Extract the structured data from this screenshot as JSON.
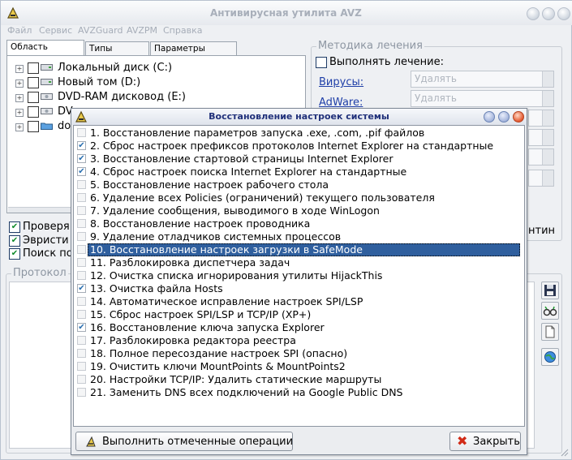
{
  "app": {
    "title": "Антивирусная утилита AVZ"
  },
  "menu": [
    "Файл",
    "Сервис",
    "AVZGuard",
    "AVZPM",
    "Справка"
  ],
  "tabs": [
    "Область поиска",
    "Типы файлов",
    "Параметры поиска"
  ],
  "drives": [
    {
      "label": "Локальный диск (C:)",
      "checked": false
    },
    {
      "label": "Новый том (D:)",
      "checked": false
    },
    {
      "label": "DVD-RAM дисковод (E:)",
      "checked": false
    },
    {
      "label": "DV",
      "checked": false
    },
    {
      "label": "do",
      "checked": false
    }
  ],
  "search_options": [
    {
      "label": "Проверя",
      "checked": true
    },
    {
      "label": "Эвристи",
      "checked": true
    },
    {
      "label": "Поиск по",
      "checked": true
    }
  ],
  "treatment": {
    "group_title": "Методика лечения",
    "perform_label": "Выполнять лечение:",
    "viruses_link": "Вирусы:",
    "adware_link": "AdWare:",
    "combo_value": "Удалять",
    "fragment": "нтин"
  },
  "protocol_label": "Протокол",
  "dialog": {
    "title": "Восстановление настроек системы",
    "items": [
      {
        "label": "1. Восстановление параметров запуска .exe, .com, .pif файлов",
        "checked": false
      },
      {
        "label": "2. Сброс настроек префиксов протоколов Internet Explorer на стандартные",
        "checked": true
      },
      {
        "label": "3. Восстановление стартовой страницы Internet Explorer",
        "checked": true
      },
      {
        "label": "4. Сброс настроек поиска Internet Explorer на стандартные",
        "checked": true
      },
      {
        "label": "5. Восстановление настроек рабочего стола",
        "checked": false
      },
      {
        "label": "6. Удаление всех Policies (ограничений) текущего пользователя",
        "checked": false
      },
      {
        "label": "7. Удаление сообщения, выводимого в ходе WinLogon",
        "checked": false
      },
      {
        "label": "8. Восстановление настроек проводника",
        "checked": false
      },
      {
        "label": "9. Удаление отладчиков системных процессов",
        "checked": false
      },
      {
        "label": "10. Восстановление настроек загрузки в SafeMode",
        "checked": false,
        "selected": true
      },
      {
        "label": "11. Разблокировка диспетчера задач",
        "checked": false
      },
      {
        "label": "12. Очистка списка игнорирования утилиты HijackThis",
        "checked": false
      },
      {
        "label": "13. Очистка файла Hosts",
        "checked": true
      },
      {
        "label": "14. Автоматическое исправление настроек SPI/LSP",
        "checked": false
      },
      {
        "label": "15. Сброс настроек SPI/LSP и TCP/IP (XP+)",
        "checked": false
      },
      {
        "label": "16. Восстановление ключа запуска Explorer",
        "checked": true
      },
      {
        "label": "17. Разблокировка редактора реестра",
        "checked": false
      },
      {
        "label": "18. Полное пересоздание настроек SPI (опасно)",
        "checked": false
      },
      {
        "label": "19. Очистить ключи MountPoints & MountPoints2",
        "checked": false
      },
      {
        "label": "20. Настройки TCP/IP: Удалить статические маршруты",
        "checked": false
      },
      {
        "label": "21. Заменить DNS всех подключений на Google Public DNS",
        "checked": false
      }
    ],
    "run_button": "Выполнить отмеченные операции",
    "close_button": "Закрыть"
  }
}
